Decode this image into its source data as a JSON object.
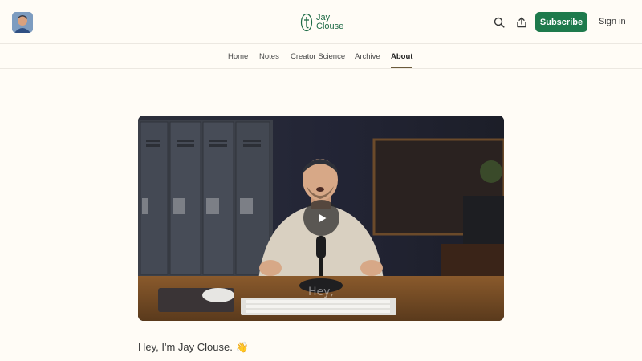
{
  "header": {
    "logo_line1": "Jay",
    "logo_line2": "Clouse",
    "subscribe_label": "Subscribe",
    "signin_label": "Sign in"
  },
  "nav": {
    "items": [
      {
        "label": "Home"
      },
      {
        "label": "Notes"
      },
      {
        "label": "Creator Science"
      },
      {
        "label": "Archive"
      },
      {
        "label": "About"
      }
    ],
    "active": "About"
  },
  "video": {
    "caption": "Hey,"
  },
  "content": {
    "intro": "Hey, I'm Jay Clouse. 👋"
  },
  "colors": {
    "background": "#fffcf6",
    "brand_green": "#1e7a4c",
    "active_underline": "#6b5a3b"
  },
  "icons": [
    "avatar",
    "logo-icon",
    "search-icon",
    "share-icon",
    "play-icon"
  ]
}
